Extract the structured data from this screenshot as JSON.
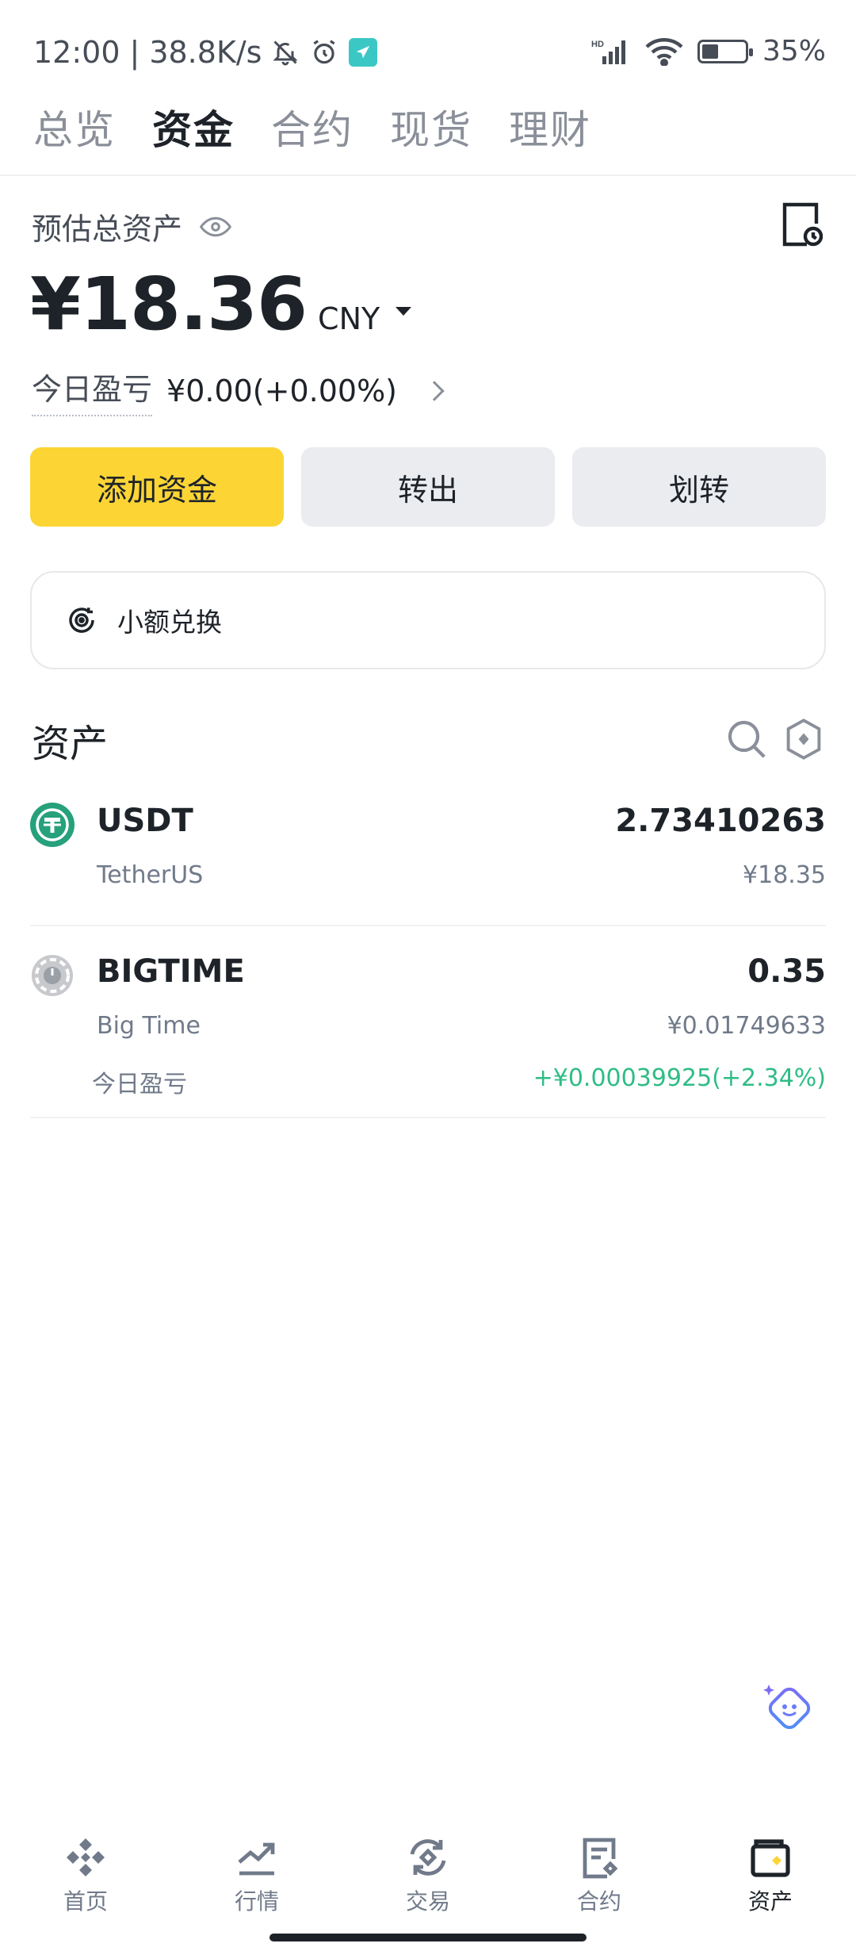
{
  "status_bar": {
    "time": "12:00",
    "net_speed": "38.8K/s",
    "network_badge": "HD",
    "battery_text": "35%",
    "battery_level": 0.35
  },
  "top_tabs": [
    {
      "label": "总览",
      "active": false
    },
    {
      "label": "资金",
      "active": true
    },
    {
      "label": "合约",
      "active": false
    },
    {
      "label": "现货",
      "active": false
    },
    {
      "label": "理财",
      "active": false
    }
  ],
  "balance": {
    "label": "预估总资产",
    "value": "¥18.36",
    "currency": "CNY",
    "pnl_label": "今日盈亏",
    "pnl_value": "¥0.00(+0.00%)"
  },
  "actions": {
    "add_funds": "添加资金",
    "withdraw": "转出",
    "transfer": "划转"
  },
  "dust": {
    "label": "小额兑换"
  },
  "assets": {
    "title": "资产",
    "items": [
      {
        "symbol": "USDT",
        "name": "TetherUS",
        "amount": "2.73410263",
        "fiat": "¥18.35"
      },
      {
        "symbol": "BIGTIME",
        "name": "Big Time",
        "amount": "0.35",
        "fiat": "¥0.01749633",
        "pnl_label": "今日盈亏",
        "pnl_value": "+¥0.00039925(+2.34%)"
      }
    ]
  },
  "bottom_nav": [
    {
      "label": "首页",
      "icon": "home-icon",
      "active": false
    },
    {
      "label": "行情",
      "icon": "markets-icon",
      "active": false
    },
    {
      "label": "交易",
      "icon": "trade-icon",
      "active": false
    },
    {
      "label": "合约",
      "icon": "futures-icon",
      "active": false
    },
    {
      "label": "资产",
      "icon": "wallet-icon",
      "active": true
    }
  ],
  "colors": {
    "brand_yellow": "#fcd535",
    "positive_green": "#2ebd85",
    "text_primary": "#1e2329",
    "text_secondary": "#707a8a"
  }
}
